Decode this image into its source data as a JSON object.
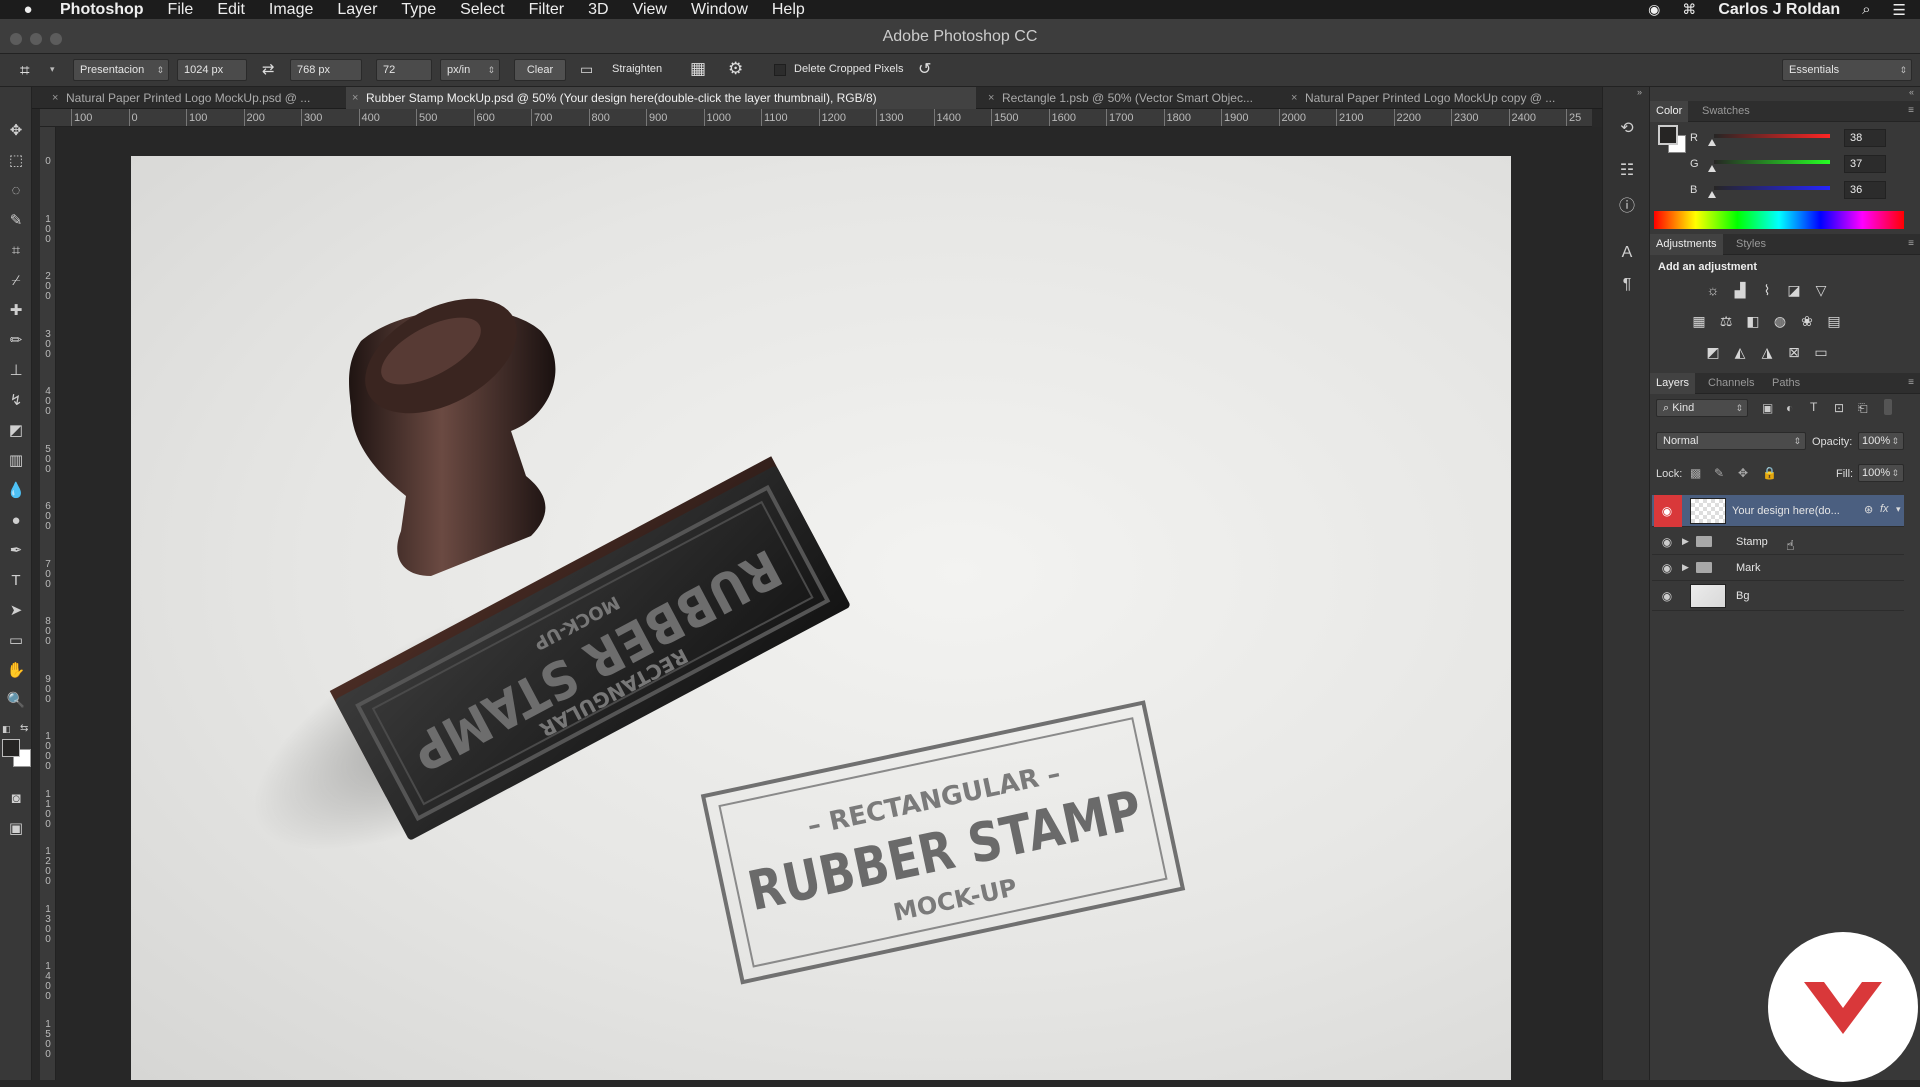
{
  "menubar": {
    "apple": "",
    "app_name": "Photoshop",
    "items": [
      "File",
      "Edit",
      "Image",
      "Layer",
      "Type",
      "Select",
      "Filter",
      "3D",
      "View",
      "Window",
      "Help"
    ],
    "user": "Carlos J Roldan"
  },
  "window": {
    "title": "Adobe Photoshop CC"
  },
  "options": {
    "preset": "Presentacion",
    "width": "1024 px",
    "height": "768 px",
    "resolution": "72",
    "units": "px/in",
    "clear_label": "Clear",
    "straighten_label": "Straighten",
    "delete_cropped_label": "Delete Cropped Pixels",
    "workspace": "Essentials"
  },
  "tabs": [
    "Natural Paper Printed Logo MockUp.psd @ ...",
    "Rubber Stamp  MockUp.psd @ 50% (Your design here(double-click the layer thumbnail), RGB/8)",
    "Rectangle 1.psb @ 50% (Vector Smart Objec...",
    "Natural Paper Printed Logo MockUp copy @ ..."
  ],
  "ruler": {
    "h_ticks": [
      "100",
      "0",
      "100",
      "200",
      "300",
      "400",
      "500",
      "600",
      "700",
      "800",
      "900",
      "1000",
      "1100",
      "1200",
      "1300",
      "1400",
      "1500",
      "1600",
      "1700",
      "1800",
      "1900",
      "2000",
      "2100",
      "2200",
      "2300",
      "2400",
      "25"
    ],
    "v_ticks": [
      "0",
      "100",
      "200",
      "300",
      "400",
      "500",
      "600",
      "700",
      "800",
      "900",
      "1000",
      "1100",
      "1200",
      "1300",
      "1400",
      "1500"
    ]
  },
  "artwork": {
    "handle_line1": "RECTANGULAR",
    "handle_line2": "RUBBER STAMP",
    "handle_line3": "MOCK-UP",
    "print_line1": "– RECTANGULAR –",
    "print_line2": "RUBBER STAMP",
    "print_line3": "MOCK-UP"
  },
  "color_panel": {
    "tabs": [
      "Color",
      "Swatches"
    ],
    "r_label": "R",
    "g_label": "G",
    "b_label": "B",
    "r": "38",
    "g": "37",
    "b": "36",
    "r_level": 0.149,
    "g_level": 0.145,
    "b_level": 0.141
  },
  "adjustments_panel": {
    "tabs": [
      "Adjustments",
      "Styles"
    ],
    "heading": "Add an adjustment"
  },
  "layers_panel": {
    "tabs": [
      "Layers",
      "Channels",
      "Paths"
    ],
    "filter": "Kind",
    "blend_mode": "Normal",
    "opacity_label": "Opacity:",
    "opacity": "100%",
    "lock_label": "Lock:",
    "fill_label": "Fill:",
    "fill": "100%",
    "layers": [
      {
        "name": "Your design here(do...",
        "type": "smart-object",
        "selected": true
      },
      {
        "name": "Stamp",
        "type": "group"
      },
      {
        "name": "Mark",
        "type": "group"
      },
      {
        "name": "Bg",
        "type": "image"
      }
    ]
  },
  "colors": {
    "accent": "#d9383a",
    "selected_layer": "#4b5f80",
    "panel_bg": "#383838"
  }
}
